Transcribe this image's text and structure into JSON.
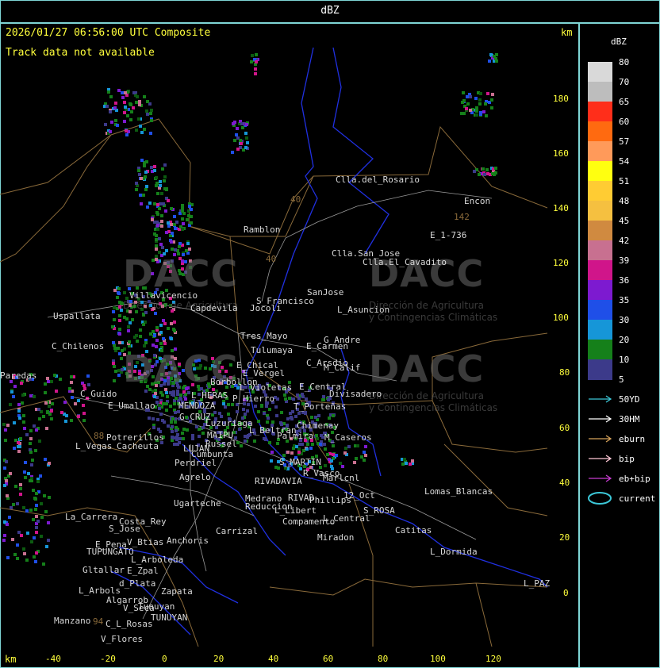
{
  "header": {
    "title": "dBZ",
    "timestamp": "2026/01/27 06:56:00 UTC Composite",
    "track_note": "Track data not available",
    "km_label": "km"
  },
  "legend": {
    "title": "dBZ",
    "scale": [
      {
        "value": "80",
        "color": "#d9d9d9"
      },
      {
        "value": "70",
        "color": "#bdbdbd"
      },
      {
        "value": "65",
        "color": "#ff2e1a"
      },
      {
        "value": "60",
        "color": "#ff6a10"
      },
      {
        "value": "57",
        "color": "#ff9a5a"
      },
      {
        "value": "54",
        "color": "#ffff10"
      },
      {
        "value": "51",
        "color": "#ffcc33"
      },
      {
        "value": "48",
        "color": "#f5c040"
      },
      {
        "value": "45",
        "color": "#d08a40"
      },
      {
        "value": "42",
        "color": "#c87090"
      },
      {
        "value": "39",
        "color": "#d0158a"
      },
      {
        "value": "36",
        "color": "#7d1ad0"
      },
      {
        "value": "35",
        "color": "#1f4fe8"
      },
      {
        "value": "30",
        "color": "#1696d8"
      },
      {
        "value": "20",
        "color": "#15801a"
      },
      {
        "value": "10",
        "color": "#0c5a10"
      },
      {
        "value": "5",
        "color": "#3c3a8a"
      }
    ],
    "tracks": [
      {
        "label": "50YD",
        "color": "#3cc8d8"
      },
      {
        "label": "30HM",
        "color": "#ffffff"
      },
      {
        "label": "eburn",
        "color": "#d6a25a"
      },
      {
        "label": "bip",
        "color": "#ffc8d6"
      },
      {
        "label": "eb+bip",
        "color": "#c83cd0"
      },
      {
        "label": "current",
        "color": "#3cc8d8"
      }
    ]
  },
  "axes": {
    "y_ticks": [
      "180",
      "160",
      "140",
      "120",
      "100",
      "80",
      "60",
      "40",
      "20",
      "0"
    ],
    "x_ticks": [
      "-40",
      "-20",
      "0",
      "20",
      "40",
      "60",
      "80",
      "100",
      "120"
    ],
    "x_km": "km"
  },
  "watermark": {
    "brand": "DACC",
    "line1": "Dirección de Agricultura",
    "line2": "y Contingencias Climáticas"
  },
  "places": {
    "p1": "Clla.del_Rosario",
    "p2": "Encon",
    "p3": "E_1-736",
    "p4": "Ramblon",
    "p5": "Clla.San_Jose",
    "p6": "Clla.El_Cavadito",
    "p7": "S_Francisco",
    "p8": "SanJose",
    "p9": "L_Asuncion",
    "p10": "Villavicencio",
    "p11": "Capdevila",
    "p12": "Jocoli",
    "p13": "Uspallata",
    "p14": "Tres_Mayo",
    "p15": "G_Andre",
    "p16": "C_Chilenos",
    "p17": "Tulumaya",
    "p18": "E_Carmen",
    "p19": "E_Chical",
    "p20": "C_Arsdio",
    "p21": "M_Calif",
    "p22": "E_Vergel",
    "p23": "Paredas",
    "p24": "Borbollon",
    "p25": "L_Violetas",
    "p26": "E_Central",
    "p27": "Divisadero",
    "p28": "L_HERAS",
    "p29": "P_Hierro",
    "p30": "C_Guido",
    "p31": "MENDOZA",
    "p32": "E_Umallao",
    "p33": "T_Porteñas",
    "p34": "G_CRUZ",
    "p35": "Luzuriaga",
    "p36": "Chimenay",
    "p37": "L_Beltran",
    "p38": "Potrerillos",
    "p39": "MAIPU",
    "p40": "Palmira",
    "p41": "M_Caseros",
    "p42": "L_Vegas",
    "p43": "Cacheuta",
    "p44": "Russel",
    "p45": "LUJAN",
    "p46": "Cumbunta",
    "p47": "Perdriel",
    "p48": "S_MARTIN",
    "p49": "Agrelo",
    "p50": "R_Vasco",
    "p51": "Marlcnl",
    "p52": "RIVADAVIA",
    "p53": "Lomas_Blancas",
    "p54": "Ugarteche",
    "p55": "Medrano",
    "p56": "Reduccion",
    "p57": "RIVAD",
    "p58": "Phillips",
    "p59": "12_Oct",
    "p60": "S_ROSA",
    "p61": "L_Libert",
    "p62": "Costa_Rey",
    "p63": "La_Carrera",
    "p64": "S_Jose",
    "p65": "L_Central",
    "p66": "Compamento",
    "p67": "Carrizal",
    "p68": "Catitas",
    "p69": "E_Pena",
    "p70": "V_Btias",
    "p71": "Anchoris",
    "p72": "TUPUNGATO",
    "p73": "Miradon",
    "p74": "L_Dormida",
    "p75": "L_Arboleda",
    "p76": "Gltallar",
    "p77": "E_Zpal",
    "p78": "d_Plata",
    "p79": "L_Arbols",
    "p80": "Zapata",
    "p81": "Algarrob",
    "p82": "V_Seca",
    "p83": "Tunuyan",
    "p84": "TUNUYAN",
    "p85": "C_L_Rosas",
    "p86": "Manzano",
    "p87": "V_Flores",
    "p88": "L_PAZ",
    "p89": "142",
    "p90": "40",
    "p91": "88",
    "p92": "40",
    "p93": "94"
  }
}
